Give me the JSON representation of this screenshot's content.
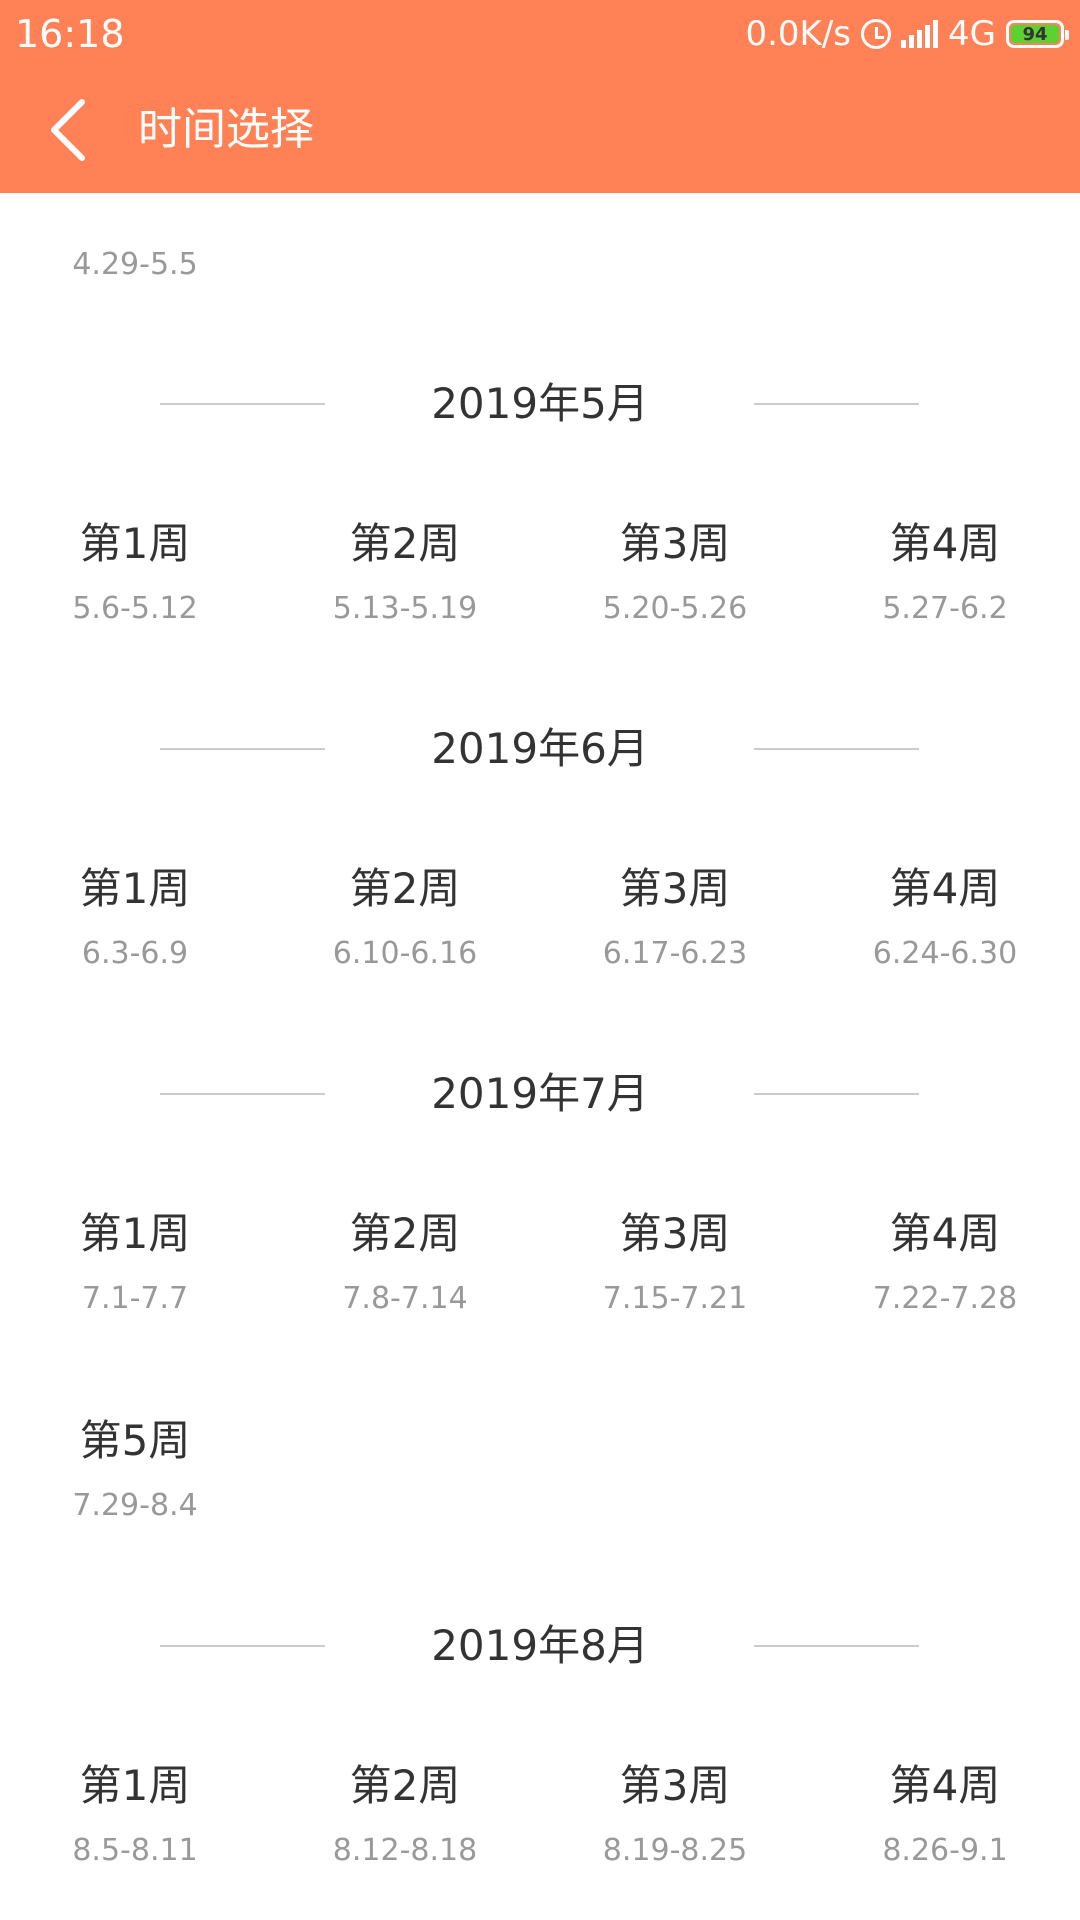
{
  "status_bar": {
    "time": "16:18",
    "speed": "0.0K/s",
    "network": "4G",
    "battery": "94"
  },
  "app_bar": {
    "title": "时间选择"
  },
  "prev_range": "4.29-5.5",
  "months": [
    {
      "label": "2019年5月",
      "weeks": [
        {
          "label": "第1周",
          "range": "5.6-5.12"
        },
        {
          "label": "第2周",
          "range": "5.13-5.19"
        },
        {
          "label": "第3周",
          "range": "5.20-5.26"
        },
        {
          "label": "第4周",
          "range": "5.27-6.2"
        }
      ]
    },
    {
      "label": "2019年6月",
      "weeks": [
        {
          "label": "第1周",
          "range": "6.3-6.9"
        },
        {
          "label": "第2周",
          "range": "6.10-6.16"
        },
        {
          "label": "第3周",
          "range": "6.17-6.23"
        },
        {
          "label": "第4周",
          "range": "6.24-6.30"
        }
      ]
    },
    {
      "label": "2019年7月",
      "weeks": [
        {
          "label": "第1周",
          "range": "7.1-7.7"
        },
        {
          "label": "第2周",
          "range": "7.8-7.14"
        },
        {
          "label": "第3周",
          "range": "7.15-7.21"
        },
        {
          "label": "第4周",
          "range": "7.22-7.28"
        },
        {
          "label": "第5周",
          "range": "7.29-8.4"
        }
      ]
    },
    {
      "label": "2019年8月",
      "weeks": [
        {
          "label": "第1周",
          "range": "8.5-8.11"
        },
        {
          "label": "第2周",
          "range": "8.12-8.18"
        },
        {
          "label": "第3周",
          "range": "8.19-8.25"
        },
        {
          "label": "第4周",
          "range": "8.26-9.1"
        }
      ]
    }
  ]
}
